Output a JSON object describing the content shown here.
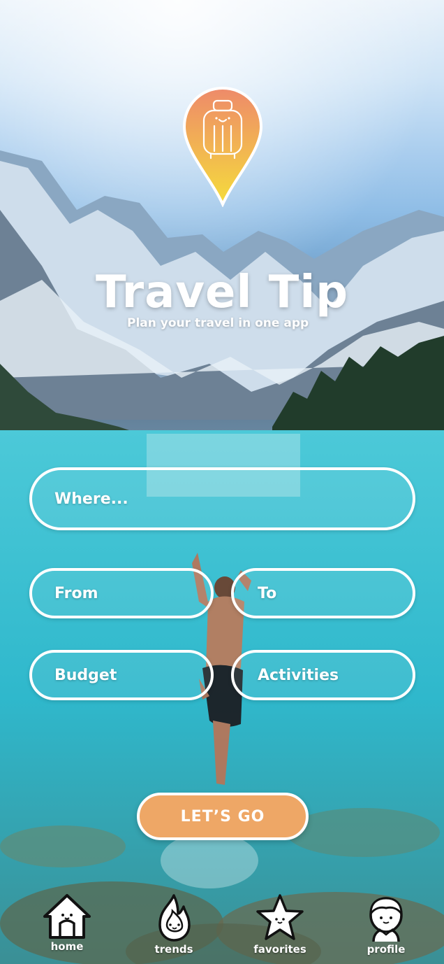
{
  "app": {
    "title": "Travel Tip",
    "subtitle": "Plan your travel in one app"
  },
  "form": {
    "where_placeholder": "Where...",
    "from_placeholder": "From",
    "to_placeholder": "To",
    "budget_placeholder": "Budget",
    "activities_placeholder": "Activities",
    "submit_label": "LET’S GO"
  },
  "nav": {
    "items": [
      {
        "label": "home",
        "icon": "home-icon"
      },
      {
        "label": "trends",
        "icon": "flame-icon"
      },
      {
        "label": "favorites",
        "icon": "star-icon"
      },
      {
        "label": "profile",
        "icon": "person-icon"
      }
    ]
  },
  "colors": {
    "accent": "#eea766",
    "pin_top": "#ee8a6a",
    "pin_bottom": "#f5dc3c"
  }
}
